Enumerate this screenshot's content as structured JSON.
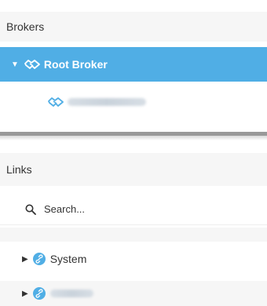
{
  "brokers": {
    "header": "Brokers",
    "root": {
      "label": "Root Broker",
      "expanded": true
    },
    "child": {
      "label": ""
    }
  },
  "links": {
    "header": "Links",
    "search": {
      "placeholder": "Search...",
      "value": ""
    },
    "items": [
      {
        "label": "System",
        "expanded": false
      },
      {
        "label": "",
        "expanded": false
      }
    ]
  },
  "icons": {
    "broker": "handshake-icon",
    "link": "link-icon",
    "search": "search-icon",
    "expand": "caret-icon"
  },
  "colors": {
    "selection": "#50aee5",
    "header_bg": "#f6f6f6",
    "link_icon": "#50aee5"
  }
}
